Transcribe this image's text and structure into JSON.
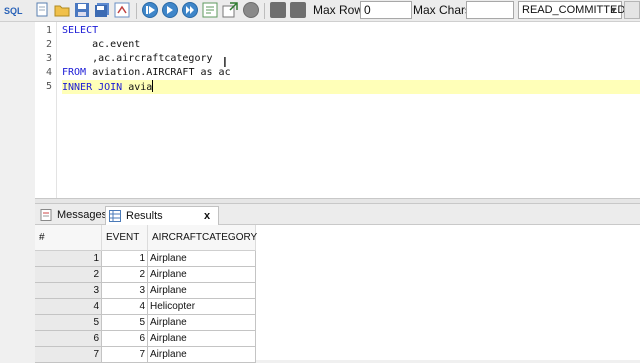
{
  "toolbar": {
    "sql_label": "SQL",
    "max_rows_label": "Max Rows:",
    "max_rows_value": "0",
    "max_chars_label": "Max Chars:",
    "max_chars_value": "",
    "isolation_value": "READ_COMMITTED"
  },
  "editor": {
    "line_numbers": [
      "1",
      "2",
      "3",
      "4",
      "5"
    ],
    "lines": [
      {
        "keyword": "SELECT",
        "text": ""
      },
      {
        "keyword": "",
        "text": "     ac.event"
      },
      {
        "keyword": "",
        "text": "     ,ac.aircraftcategory"
      },
      {
        "keyword": "FROM",
        "text": " aviation.AIRCRAFT as ac"
      },
      {
        "keyword": "INNER JOIN",
        "text": " avia"
      }
    ],
    "keyword_color": "#1a1ad6",
    "current_line_color": "#ffffb8"
  },
  "tabs": {
    "messages": "Messages",
    "results": "Results",
    "close": "x"
  },
  "grid": {
    "columns": [
      "#",
      "EVENT",
      "AIRCRAFTCATEGORY"
    ],
    "rows": [
      [
        "1",
        "1",
        "Airplane"
      ],
      [
        "2",
        "2",
        "Airplane"
      ],
      [
        "3",
        "3",
        "Airplane"
      ],
      [
        "4",
        "4",
        "Helicopter"
      ],
      [
        "5",
        "5",
        "Airplane"
      ],
      [
        "6",
        "6",
        "Airplane"
      ],
      [
        "7",
        "7",
        "Airplane"
      ]
    ]
  }
}
